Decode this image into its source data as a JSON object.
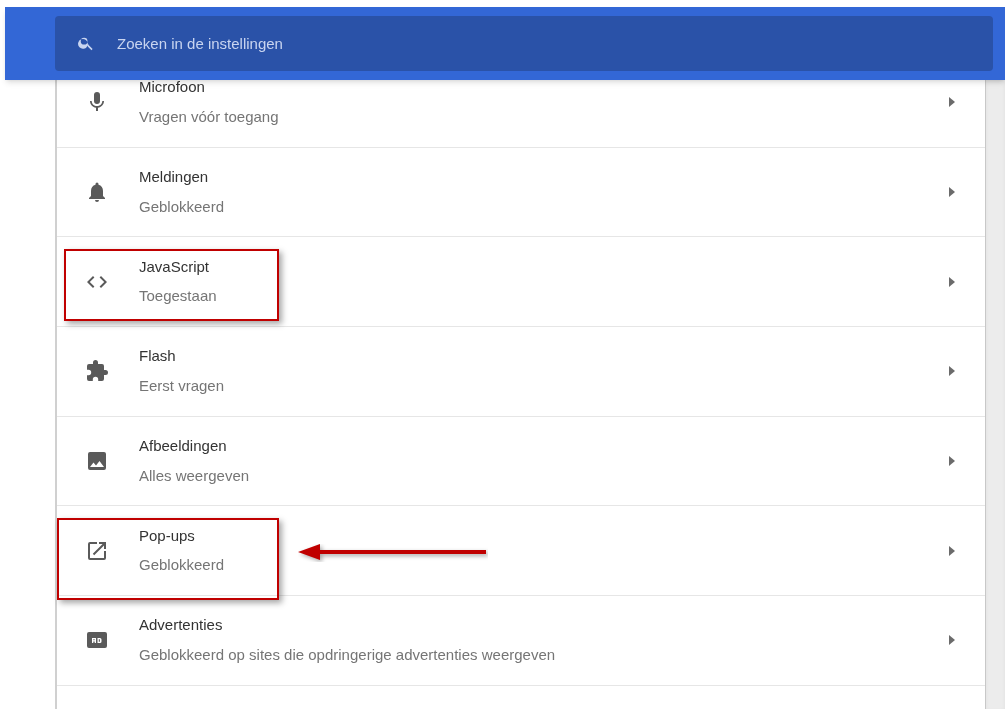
{
  "search": {
    "placeholder": "Zoeken in de instellingen"
  },
  "rows": [
    {
      "kind": "microphone",
      "title": "Microfoon",
      "subtitle": "Vragen vóór toegang",
      "highlighted": false,
      "arrow": false
    },
    {
      "kind": "bell",
      "title": "Meldingen",
      "subtitle": "Geblokkeerd",
      "highlighted": false,
      "arrow": false
    },
    {
      "kind": "code",
      "title": "JavaScript",
      "subtitle": "Toegestaan",
      "highlighted": true,
      "arrow": false
    },
    {
      "kind": "puzzle",
      "title": "Flash",
      "subtitle": "Eerst vragen",
      "highlighted": false,
      "arrow": false
    },
    {
      "kind": "image",
      "title": "Afbeeldingen",
      "subtitle": "Alles weergeven",
      "highlighted": false,
      "arrow": false
    },
    {
      "kind": "popup",
      "title": "Pop-ups",
      "subtitle": "Geblokkeerd",
      "highlighted": true,
      "arrow": true
    },
    {
      "kind": "ad",
      "title": "Advertenties",
      "subtitle": "Geblokkeerd op sites die opdringerige advertenties weergeven",
      "highlighted": false,
      "arrow": false
    }
  ]
}
